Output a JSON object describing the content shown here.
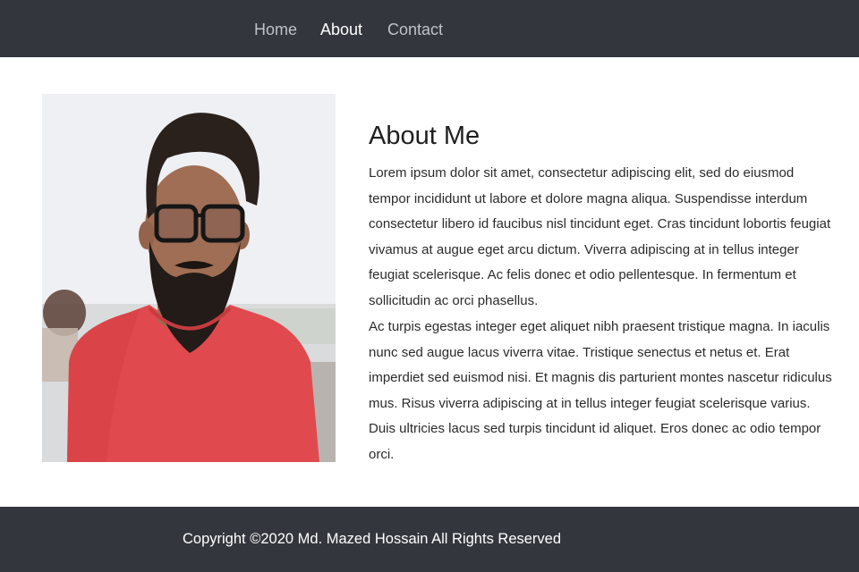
{
  "nav": {
    "items": [
      {
        "label": "Home"
      },
      {
        "label": "About"
      },
      {
        "label": "Contact"
      }
    ]
  },
  "about": {
    "title": "About Me",
    "paragraphs": [
      "Lorem ipsum dolor sit amet, consectetur adipiscing elit, sed do eiusmod tempor incididunt ut labore et dolore magna aliqua. Suspendisse interdum consectetur libero id faucibus nisl tincidunt eget. Cras tincidunt lobortis feugiat vivamus at augue eget arcu dictum. Viverra adipiscing at in tellus integer feugiat scelerisque. Ac felis donec et odio pellentesque. In fermentum et sollicitudin ac orci phasellus.",
      "Ac turpis egestas integer eget aliquet nibh praesent tristique magna. In iaculis nunc sed augue lacus viverra vitae. Tristique senectus et netus et. Erat imperdiet sed euismod nisi. Et magnis dis parturient montes nascetur ridiculus mus. Risus viverra adipiscing at in tellus integer feugiat scelerisque varius. Duis ultricies lacus sed turpis tincidunt id aliquet. Eros donec ac odio tempor orci."
    ]
  },
  "footer": {
    "copyright": "Copyright ©2020 Md. Mazed Hossain All Rights Reserved"
  },
  "colors": {
    "nav_background": "#33373d",
    "nav_active": "#ffffff",
    "nav_inactive": "#bfc3c7",
    "footer_background": "#33373d"
  },
  "images": {
    "profile_photo": "portrait of bearded man in glasses and red t-shirt"
  }
}
